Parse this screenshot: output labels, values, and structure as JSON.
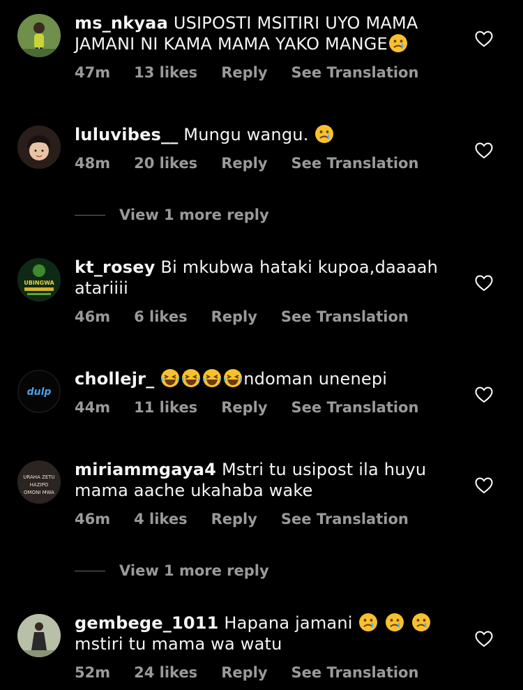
{
  "comments": [
    {
      "username": "ms_nkyaa",
      "text": "USIPOSTI MSITIRI UYO MAMA JAMANI NI KAMA MAMA YAKO MANGE",
      "emojis": [
        "crying-face"
      ],
      "time": "47m",
      "likes": "13 likes",
      "reply": "Reply",
      "translate": "See Translation"
    },
    {
      "username": "luluvibes__",
      "text": "Mungu wangu.",
      "emojis": [
        "crying-face"
      ],
      "time": "48m",
      "likes": "20 likes",
      "reply": "Reply",
      "translate": "See Translation",
      "view_more": "View 1 more reply"
    },
    {
      "username": "kt_rosey",
      "text": "Bi mkubwa hataki kupoa,daaaah atariiii",
      "avatar_text": "UBINGWA",
      "time": "46m",
      "likes": "6 likes",
      "reply": "Reply",
      "translate": "See Translation"
    },
    {
      "username": "chollejr_",
      "text": "ndoman unenepi",
      "emojis": [
        "laughing-face",
        "laughing-face",
        "laughing-face",
        "laughing-face"
      ],
      "avatar_text": "dulp",
      "time": "44m",
      "likes": "11 likes",
      "reply": "Reply",
      "translate": "See Translation"
    },
    {
      "username": "miriammgaya4",
      "text": "Mstri tu usipost ila huyu mama aache ukahaba wake",
      "avatar_text": [
        "URAHA ZETU",
        "HAZIPO",
        "OMONI MWA"
      ],
      "time": "46m",
      "likes": "4 likes",
      "reply": "Reply",
      "translate": "See Translation",
      "view_more": "View 1 more reply"
    },
    {
      "username": "gembege_1011",
      "text": "Hapana jamani",
      "emojis": [
        "crying-face",
        "crying-face",
        "crying-face"
      ],
      "text2": "mstiri tu mama wa watu",
      "time": "52m",
      "likes": "24 likes",
      "reply": "Reply",
      "translate": "See Translation"
    }
  ],
  "colors": {
    "background": "#000000",
    "meta": "#9a9a9a",
    "text": "#f5f5f5"
  }
}
